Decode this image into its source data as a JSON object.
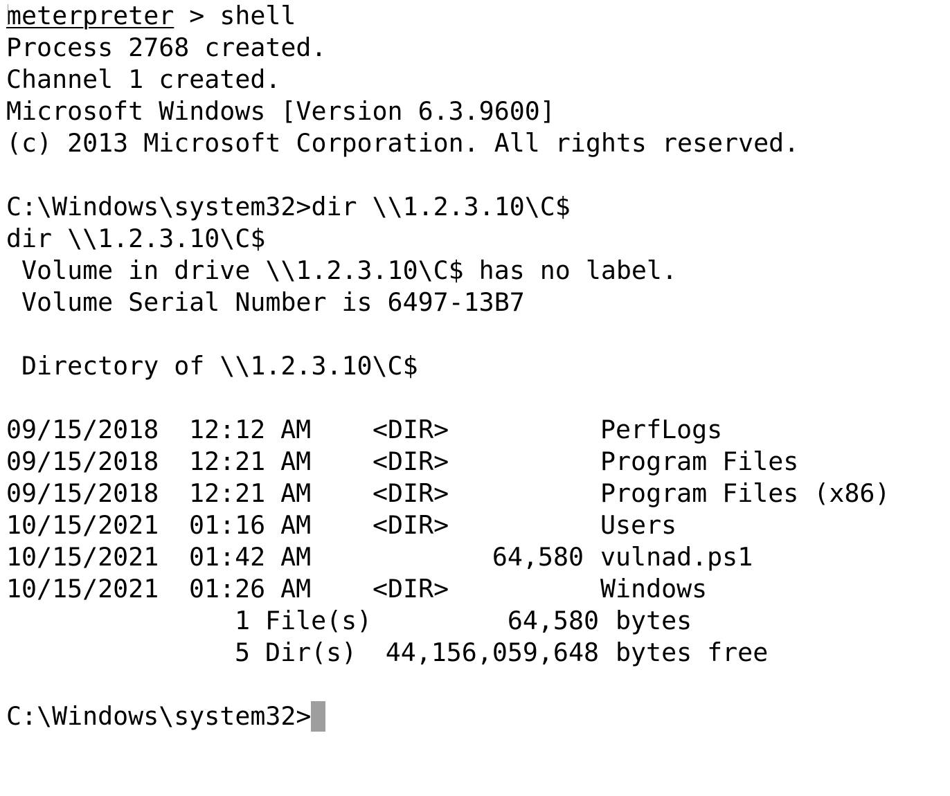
{
  "session": {
    "prompt_label": "meterpreter",
    "prompt_sep": " > ",
    "command": "shell"
  },
  "intro_lines": [
    "Process 2768 created.",
    "Channel 1 created.",
    "Microsoft Windows [Version 6.3.9600]",
    "(c) 2013 Microsoft Corporation. All rights reserved."
  ],
  "dir_command": {
    "prompt": "C:\\Windows\\system32>",
    "command": "dir \\\\1.2.3.10\\C$",
    "echo": "dir \\\\1.2.3.10\\C$"
  },
  "volume": {
    "label_line": " Volume in drive \\\\1.2.3.10\\C$ has no label.",
    "serial_line": " Volume Serial Number is 6497-13B7",
    "directory_line": " Directory of \\\\1.2.3.10\\C$"
  },
  "listing": [
    {
      "date": "09/15/2018",
      "time": "12:12 AM",
      "type": "<DIR>",
      "size": "",
      "name": "PerfLogs"
    },
    {
      "date": "09/15/2018",
      "time": "12:21 AM",
      "type": "<DIR>",
      "size": "",
      "name": "Program Files"
    },
    {
      "date": "09/15/2018",
      "time": "12:21 AM",
      "type": "<DIR>",
      "size": "",
      "name": "Program Files (x86)"
    },
    {
      "date": "10/15/2021",
      "time": "01:16 AM",
      "type": "<DIR>",
      "size": "",
      "name": "Users"
    },
    {
      "date": "10/15/2021",
      "time": "01:42 AM",
      "type": "",
      "size": "64,580",
      "name": "vulnad.ps1"
    },
    {
      "date": "10/15/2021",
      "time": "01:26 AM",
      "type": "<DIR>",
      "size": "",
      "name": "Windows"
    }
  ],
  "summary": {
    "files_count": "1 File(s)",
    "files_bytes": "64,580",
    "files_label": "bytes",
    "dirs_count": "5 Dir(s)",
    "dirs_bytes": "44,156,059,648",
    "dirs_label": "bytes free"
  },
  "final_prompt": "C:\\Windows\\system32>"
}
